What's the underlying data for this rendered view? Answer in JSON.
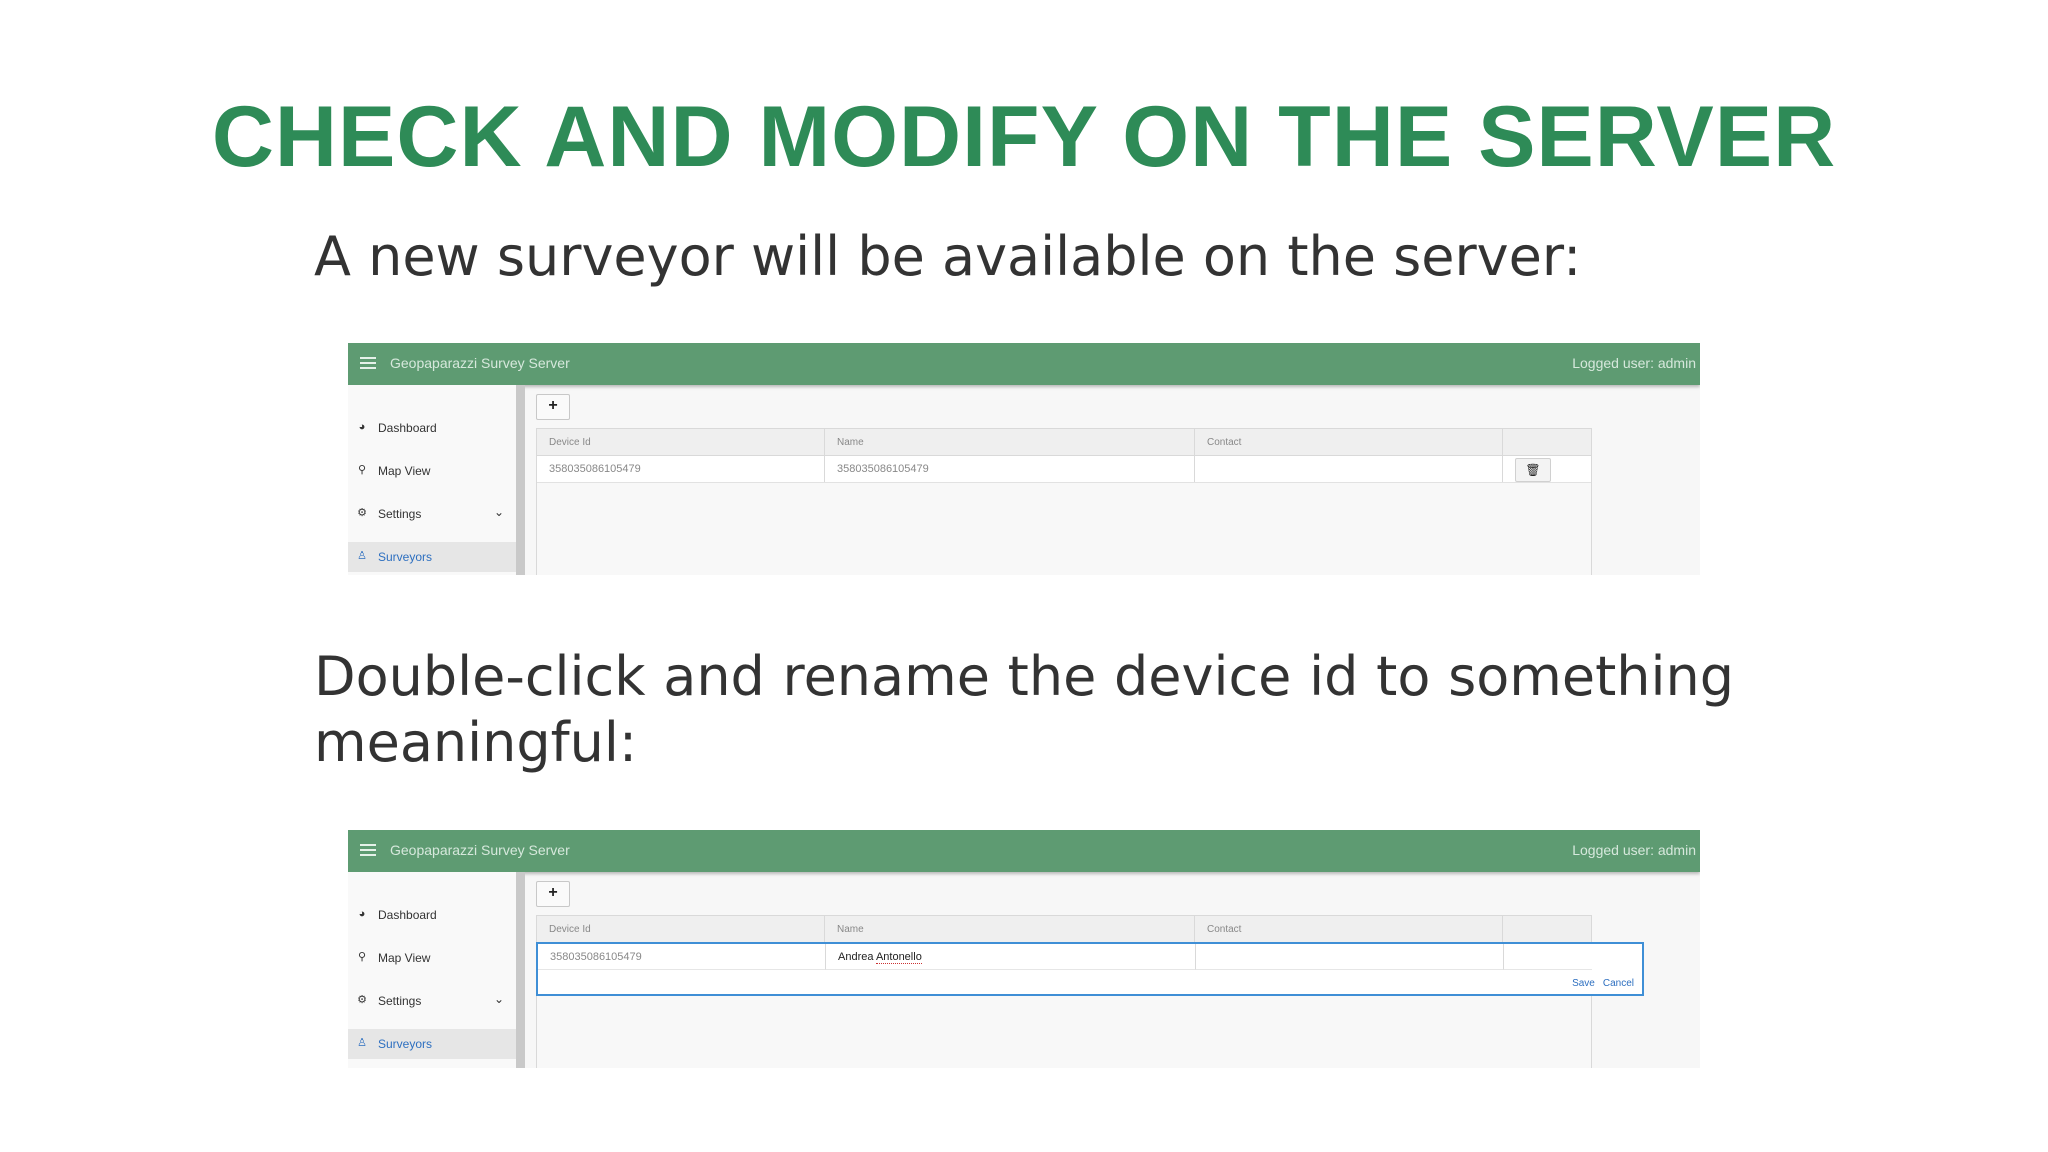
{
  "slide": {
    "title": "CHECK AND MODIFY ON THE SERVER",
    "para1": "A new surveyor will be available on the server:",
    "para2": "Double-click and rename the device id to something meaningful:"
  },
  "app": {
    "title": "Geopaparazzi Survey Server",
    "logged_user": "Logged user: admin",
    "accent_color": "#5e9b72",
    "nav": [
      {
        "label": "Dashboard",
        "icon": "dashboard-icon"
      },
      {
        "label": "Map View",
        "icon": "map-pin-icon"
      },
      {
        "label": "Settings",
        "icon": "gears-icon"
      },
      {
        "label": "Surveyors",
        "icon": "person-icon",
        "active": true
      }
    ],
    "add_button": "+",
    "columns": [
      "Device Id",
      "Name",
      "Contact",
      ""
    ]
  },
  "shot1": {
    "row": {
      "device_id": "358035086105479",
      "name": "358035086105479",
      "contact": ""
    }
  },
  "shot2": {
    "row": {
      "device_id": "358035086105479",
      "name_first": "Andrea",
      "name_last": "Antonello",
      "contact": ""
    },
    "save_label": "Save",
    "cancel_label": "Cancel"
  }
}
